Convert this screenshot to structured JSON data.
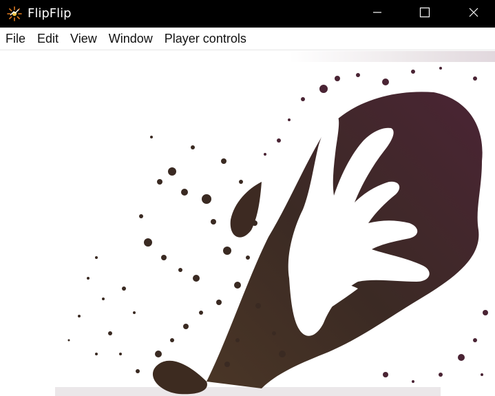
{
  "window": {
    "title": "FlipFlip",
    "app_icon": "flipflip-logo-icon",
    "controls": {
      "minimize_icon": "minimize-icon",
      "maximize_icon": "maximize-icon",
      "close_icon": "close-icon"
    }
  },
  "menu": {
    "items": [
      {
        "label": "File"
      },
      {
        "label": "Edit"
      },
      {
        "label": "View"
      },
      {
        "label": "Window"
      },
      {
        "label": "Player controls"
      }
    ]
  },
  "colors": {
    "titlebar_bg": "#000000",
    "titlebar_text": "#ffffff",
    "menubar_bg": "#ffffff",
    "content_bg": "#ffffff",
    "splatter_dark": "#3a2424",
    "splatter_brown": "#5a4030",
    "splatter_purple": "#4a2030"
  },
  "content": {
    "image_description_icon": "ink-splatter-hand-image"
  }
}
